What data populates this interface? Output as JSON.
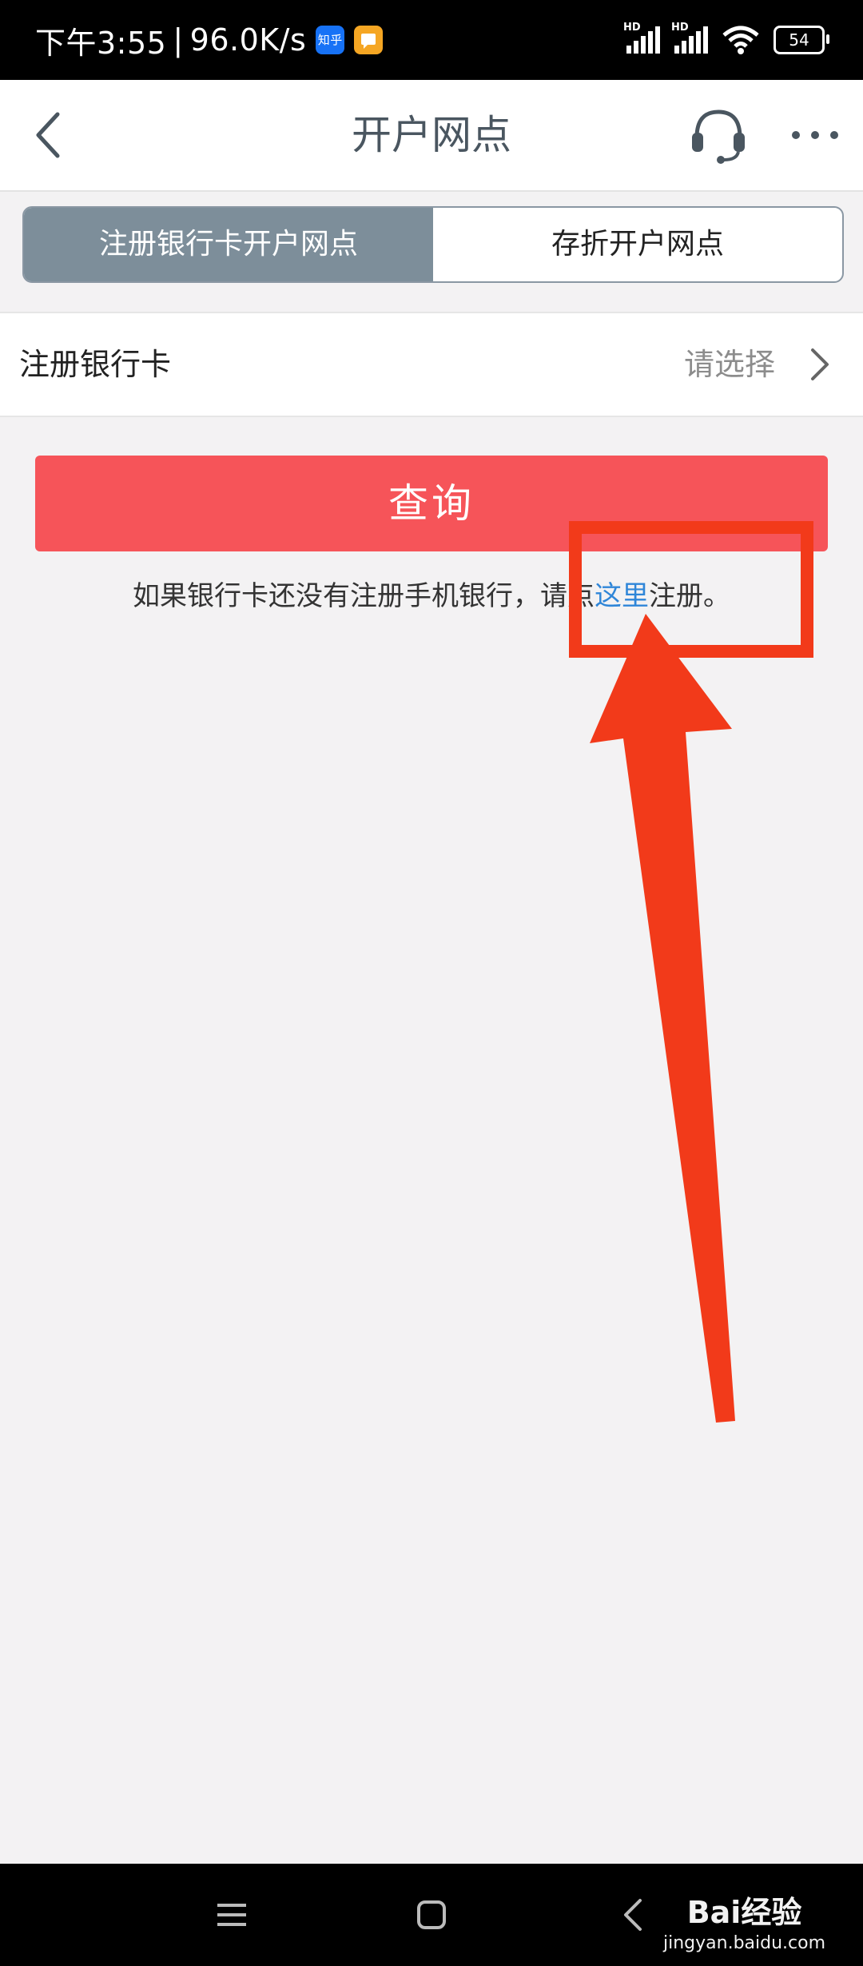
{
  "status_bar": {
    "time": "下午3:55",
    "separator": "|",
    "network_speed": "96.0K/s",
    "app_badges": [
      {
        "name": "zhihu-icon",
        "label": "知乎",
        "color": "#1772f6"
      },
      {
        "name": "message-icon",
        "label": "",
        "color": "#f5a623"
      }
    ],
    "signal_labels": [
      "HD",
      "HD"
    ],
    "battery": "54"
  },
  "header": {
    "title": "开户网点",
    "icons": [
      "back-icon",
      "headset-icon",
      "more-icon"
    ]
  },
  "tabs": [
    {
      "label": "注册银行卡开户网点",
      "active": true
    },
    {
      "label": "存折开户网点",
      "active": false
    }
  ],
  "select_row": {
    "label": "注册银行卡",
    "value": "请选择"
  },
  "query_button": {
    "label": "查询",
    "color": "#f65459"
  },
  "hint": {
    "prefix": "如果银行卡还没有注册手机银行，请点",
    "link": "这里",
    "suffix": "注册。",
    "link_color": "#2f86d8"
  },
  "annotation": {
    "color": "#f23a1a"
  },
  "system_nav": {
    "icons": [
      "menu-icon",
      "home-icon",
      "back-nav-icon"
    ],
    "watermark": "Bai经验",
    "watermark_sub": "jingyan.baidu.com"
  }
}
